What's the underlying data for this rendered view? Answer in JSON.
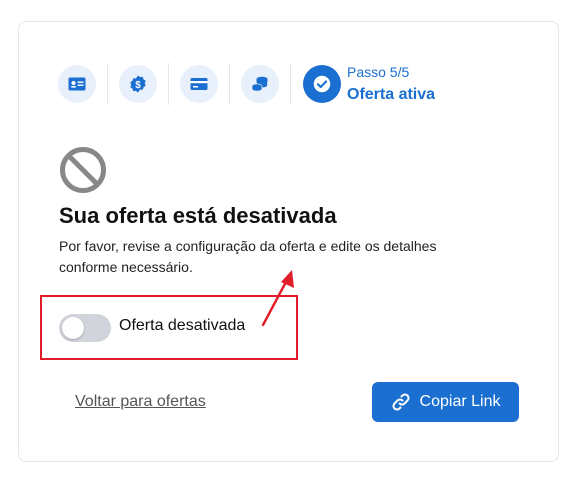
{
  "stepper": {
    "steps": [
      {
        "icon": "id-card-icon"
      },
      {
        "icon": "dollar-badge-icon"
      },
      {
        "icon": "credit-card-icon"
      },
      {
        "icon": "coins-icon"
      }
    ],
    "active_icon": "check-circle-icon",
    "current_step": "Passo 5/5",
    "current_label": "Oferta ativa"
  },
  "status": {
    "icon": "ban-icon",
    "title": "Sua oferta está desativada",
    "description": "Por favor, revise a configuração da oferta e edite os detalhes conforme necessário."
  },
  "toggle": {
    "label": "Oferta desativada",
    "enabled": false
  },
  "actions": {
    "back_label": "Voltar para ofertas",
    "copy_label": "Copiar Link",
    "copy_icon": "link-icon"
  },
  "colors": {
    "accent": "#1a6fd0",
    "accent_light": "#e8f0fb",
    "highlight": "#e11d2a",
    "toggle_off": "#d1d5db"
  }
}
